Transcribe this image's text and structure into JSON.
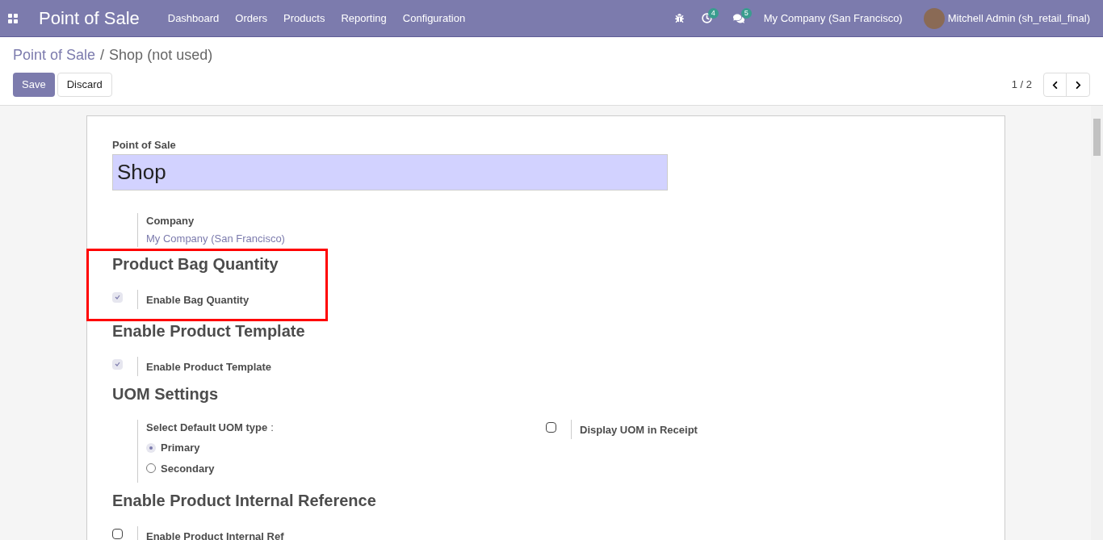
{
  "navbar": {
    "app_title": "Point of Sale",
    "menu": [
      "Dashboard",
      "Orders",
      "Products",
      "Reporting",
      "Configuration"
    ],
    "activity_count": "4",
    "message_count": "5",
    "company": "My Company (San Francisco)",
    "user": "Mitchell Admin (sh_retail_final)"
  },
  "breadcrumb": [
    {
      "label": "Point of Sale",
      "kind": "link"
    },
    {
      "label": "Shop (not used)",
      "kind": "current"
    }
  ],
  "buttons": [
    {
      "label": "Save",
      "kind": "primary"
    },
    {
      "label": "Discard",
      "kind": "secondary"
    }
  ],
  "breadcrumb_separator": "/",
  "pager": "1 / 2",
  "form": {
    "name_label": "Point of Sale",
    "name_value": "Shop",
    "company_label": "Company",
    "company_value": "My Company (San Francisco)",
    "sections": [
      {
        "title": "Product Bag Quantity",
        "highlighted": true,
        "fields": [
          {
            "kind": "checkbox",
            "label": "Enable Bag Quantity",
            "checked": true,
            "disabled": true
          }
        ]
      },
      {
        "title": "Enable Product Template",
        "highlighted": false,
        "fields": [
          {
            "kind": "checkbox",
            "label": "Enable Product Template",
            "checked": true,
            "disabled": true
          }
        ]
      },
      {
        "title": "UOM Settings",
        "highlighted": false,
        "fields": [
          {
            "kind": "radio",
            "label": "Select Default UOM type",
            "colon": ":",
            "options": [
              {
                "label": "Primary",
                "selected": true
              },
              {
                "label": "Secondary",
                "selected": false
              }
            ]
          },
          {
            "kind": "checkbox",
            "label": "Display UOM in Receipt",
            "checked": false,
            "disabled": false
          }
        ]
      },
      {
        "title": "Enable Product Internal Reference",
        "highlighted": false,
        "fields": [
          {
            "kind": "checkbox",
            "label": "Enable Product Internal Ref",
            "checked": false,
            "disabled": false
          }
        ]
      }
    ]
  }
}
